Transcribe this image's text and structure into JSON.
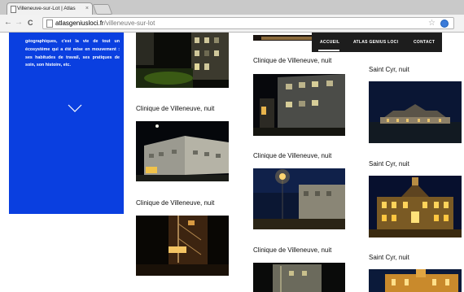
{
  "browser": {
    "tab_title": "Villeneuve-sur-Lot | Atlas",
    "tab_close": "×",
    "url_host": "atlasgeniusloci.fr",
    "url_path": "/villeneuve-sur-lot",
    "back": "←",
    "forward": "→",
    "reload": "C",
    "star": "☆"
  },
  "sidebar": {
    "text": "géographiques, c'est la vie de tout un écosystème qui a été mise en mouvement : ses habitudes de travail, ses pratiques de soin, son histoire, etc."
  },
  "nav": {
    "items": [
      "ACCUEIL",
      "ATLAS GENIUS LOCI",
      "CONTACT"
    ]
  },
  "captions": {
    "col1_a": "Clinique de Villeneuve, nuit",
    "col1_b": "Clinique de Villeneuve, nuit",
    "col2_a": "Clinique de Villeneuve, nuit",
    "col2_b": "Clinique de Villeneuve, nuit",
    "col2_c": "Clinique de Villeneuve, nuit",
    "col3_a": "Saint Cyr, nuit",
    "col3_b": "Saint Cyr, nuit",
    "col3_c": "Saint Cyr, nuit"
  }
}
